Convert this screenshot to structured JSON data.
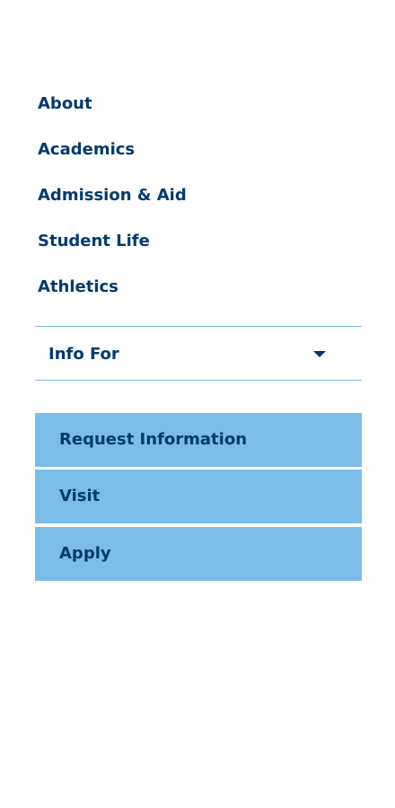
{
  "nav": {
    "items": [
      {
        "label": "About"
      },
      {
        "label": "Academics"
      },
      {
        "label": "Admission & Aid"
      },
      {
        "label": "Student Life"
      },
      {
        "label": "Athletics"
      }
    ]
  },
  "info_for": {
    "label": "Info For",
    "icon": "caret-down-icon"
  },
  "cta": {
    "request_info": "Request Information",
    "visit": "Visit",
    "apply": "Apply"
  },
  "colors": {
    "text": "#003a70",
    "cta_background": "#7bbde8",
    "divider": "#7bbfe3",
    "background": "#ffffff"
  }
}
